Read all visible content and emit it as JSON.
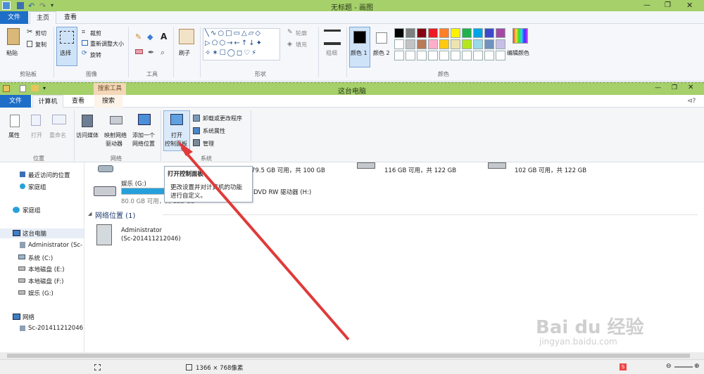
{
  "paint": {
    "title": "无标题 - 画图",
    "tab_file": "文件",
    "tab_home": "主页",
    "tab_view": "查看",
    "clipboard": {
      "paste": "粘贴",
      "cut": "剪切",
      "copy": "复制",
      "group": "剪贴板"
    },
    "image": {
      "select": "选择",
      "crop": "裁剪",
      "resize": "重新调整大小",
      "rotate": "旋转",
      "group": "图像"
    },
    "tools": {
      "group": "工具"
    },
    "brush": {
      "label": "刷子"
    },
    "shapes": {
      "outline": "轮廓",
      "fill": "填充",
      "group": "形状"
    },
    "size": {
      "label": "粗细"
    },
    "colors": {
      "color1": "颜色 1",
      "color2": "颜色 2",
      "edit": "编辑颜色",
      "group": "颜色",
      "palette_row1": [
        "#000000",
        "#7f7f7f",
        "#880015",
        "#ed1c24",
        "#ff7f27",
        "#fff200",
        "#22b14c",
        "#00a2e8",
        "#3f48cc",
        "#a349a4"
      ],
      "palette_row2": [
        "#ffffff",
        "#c3c3c3",
        "#b97a57",
        "#ffaec9",
        "#ffc90e",
        "#efe4b0",
        "#b5e61d",
        "#99d9ea",
        "#7092be",
        "#c8bfe7"
      ]
    }
  },
  "explorer": {
    "title": "这台电脑",
    "search_tools": "搜索工具",
    "tab_file": "文件",
    "tab_computer": "计算机",
    "tab_view": "查看",
    "tab_search": "搜索",
    "location": {
      "properties": "属性",
      "open": "打开",
      "rename": "重命名",
      "group": "位置"
    },
    "network": {
      "access_media": "访问媒体",
      "map_drive_1": "映射网络",
      "map_drive_2": "驱动器",
      "add_location_1": "添加一个",
      "add_location_2": "网络位置",
      "group": "网络"
    },
    "system": {
      "open_cp_1": "打开",
      "open_cp_2": "控制面板",
      "uninstall": "卸载或更改程序",
      "sys_props": "系统属性",
      "manage": "管理",
      "group": "系统"
    },
    "nav": {
      "recent": "最近访问的位置",
      "homegroup1": "家庭组",
      "homegroup2": "家庭组",
      "thispc": "这台电脑",
      "admin": "Administrator (Sc-",
      "sys_c": "系统 (C:)",
      "disk_e": "本地磁盘 (E:)",
      "disk_f": "本地磁盘 (F:)",
      "ent_g": "娱乐 (G:)",
      "network": "网络",
      "sc_host": "Sc-201411212046"
    },
    "drives": {
      "d1_free": "79.5 GB 可用，共 100 GB",
      "d2_free": "116 GB 可用，共 122 GB",
      "d3_free": "102 GB 可用，共 122 GB",
      "g_name": "娱乐 (G:)",
      "g_free": "80.0 GB 可用，共 122 GB",
      "g_fill": 0.35,
      "dvd": "DVD RW 驱动器 (H:)"
    },
    "netloc": {
      "header": "网络位置 (1)",
      "name": "Administrator",
      "host": "(Sc-201411212046)"
    },
    "tooltip": {
      "title": "打开控制面板",
      "desc1": "更改设置并对计算机的功能",
      "desc2": "进行自定义。"
    },
    "status": {
      "dimensions": "1366 × 768像素"
    },
    "watermark": {
      "logo": "Bai du 经验",
      "url": "jingyan.baidu.com"
    }
  }
}
